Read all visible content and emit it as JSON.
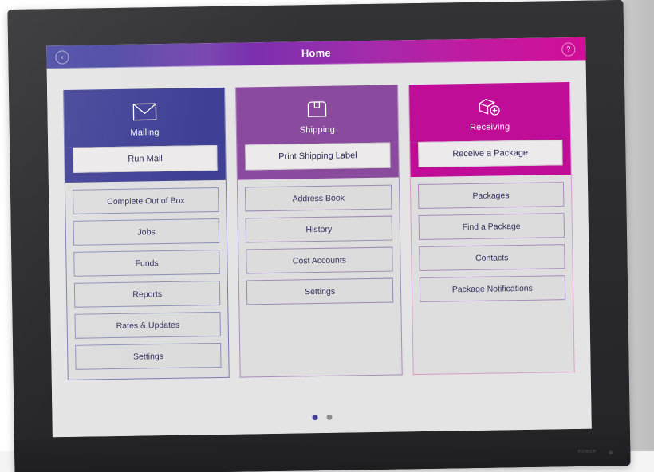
{
  "device": {
    "brand_mark": "",
    "power_label": "POWER"
  },
  "topbar": {
    "title": "Home",
    "back_icon": "‹",
    "help_icon": "?"
  },
  "columns": [
    {
      "key": "mailing",
      "title": "Mailing",
      "icon": "envelope-icon",
      "header_color": "#3f3f96",
      "primary": "Run Mail",
      "items": [
        "Complete Out of Box",
        "Jobs",
        "Funds",
        "Reports",
        "Rates & Updates",
        "Settings"
      ]
    },
    {
      "key": "shipping",
      "title": "Shipping",
      "icon": "package-box-icon",
      "header_color": "#8a4a9e",
      "primary": "Print Shipping Label",
      "items": [
        "Address Book",
        "History",
        "Cost Accounts",
        "Settings"
      ]
    },
    {
      "key": "receiving",
      "title": "Receiving",
      "icon": "package-add-icon",
      "header_color": "#c00d98",
      "primary": "Receive a Package",
      "items": [
        "Packages",
        "Find a Package",
        "Contacts",
        "Package Notifications"
      ]
    }
  ],
  "pager": {
    "count": 2,
    "active_index": 0
  },
  "colors": {
    "mailing": "#3f3f96",
    "shipping": "#8a4a9e",
    "receiving": "#c00d98",
    "screen_bg": "#e4e4e4",
    "bezel": "#2b2b2e"
  }
}
